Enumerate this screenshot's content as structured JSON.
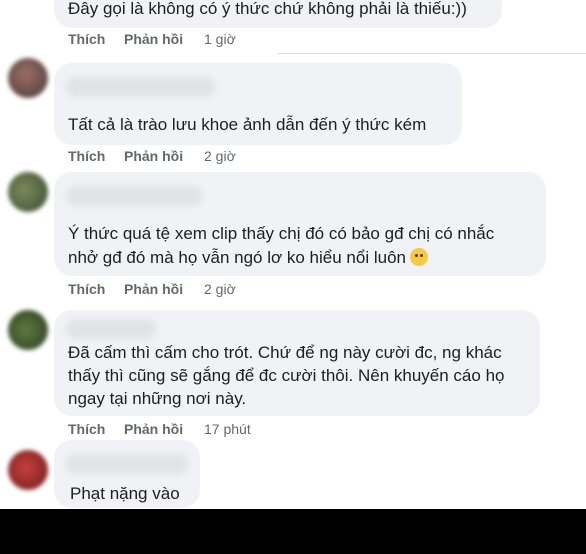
{
  "comments": [
    {
      "lines": [
        "Đây gọi là không có ý thức chứ không phải là thiếu:))"
      ],
      "like": "Thích",
      "reply": "Phản hồi",
      "time": "1 giờ"
    },
    {
      "lines": [
        "Tất cả là trào lưu khoe ảnh dẫn đến ý thức kém"
      ],
      "like": "Thích",
      "reply": "Phản hồi",
      "time": "2 giờ"
    },
    {
      "lines": [
        "Ý thức quá tệ xem clip thấy chị đó có bảo gđ chị có nhắc",
        "nhở gđ đó mà họ vẫn ngó lơ ko hiểu nổi luôn"
      ],
      "emoji": "worried-face-emoji",
      "like": "Thích",
      "reply": "Phản hồi",
      "time": "2 giờ"
    },
    {
      "lines": [
        "Đã cấm thì cấm cho trót. Chứ để ng này cười đc, ng khác",
        "thấy thì cũng sẽ gắng để đc cười thôi. Nên khuyến cáo họ",
        "ngay tại những nơi này."
      ],
      "like": "Thích",
      "reply": "Phản hồi",
      "time": "17 phút"
    },
    {
      "lines": [
        "Phạt nặng vào"
      ]
    }
  ]
}
